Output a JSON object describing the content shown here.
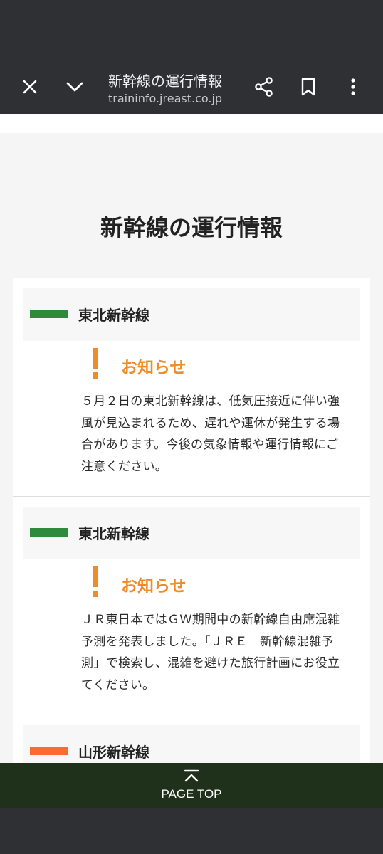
{
  "browser": {
    "page_title": "新幹線の運行情報",
    "url": "traininfo.jreast.co.jp"
  },
  "page": {
    "heading": "新幹線の運行情報"
  },
  "lines": [
    {
      "name": "東北新幹線",
      "color": "#2e8b3e",
      "notice_label": "お知らせ",
      "notice_text": "５月２日の東北新幹線は、低気圧接近に伴い強風が見込まれるため、遅れや運休が発生する場合があります。今後の気象情報や運行情報にご注意ください。"
    },
    {
      "name": "東北新幹線",
      "color": "#2e8b3e",
      "notice_label": "お知らせ",
      "notice_text": "ＪＲ東日本ではＧＷ期間中の新幹線自由席混雑予測を発表しました。「ＪＲＥ　新幹線混雑予測」で検索し、混雑を避けた旅行計画にお役立てください。"
    },
    {
      "name": "山形新幹線",
      "color": "#ff6a33"
    }
  ],
  "footer": {
    "page_top_label": "PAGE TOP"
  },
  "colors": {
    "toolbar": "#2f3033",
    "notice_orange": "#ef8c2a",
    "page_top_bg": "#1f301b"
  }
}
